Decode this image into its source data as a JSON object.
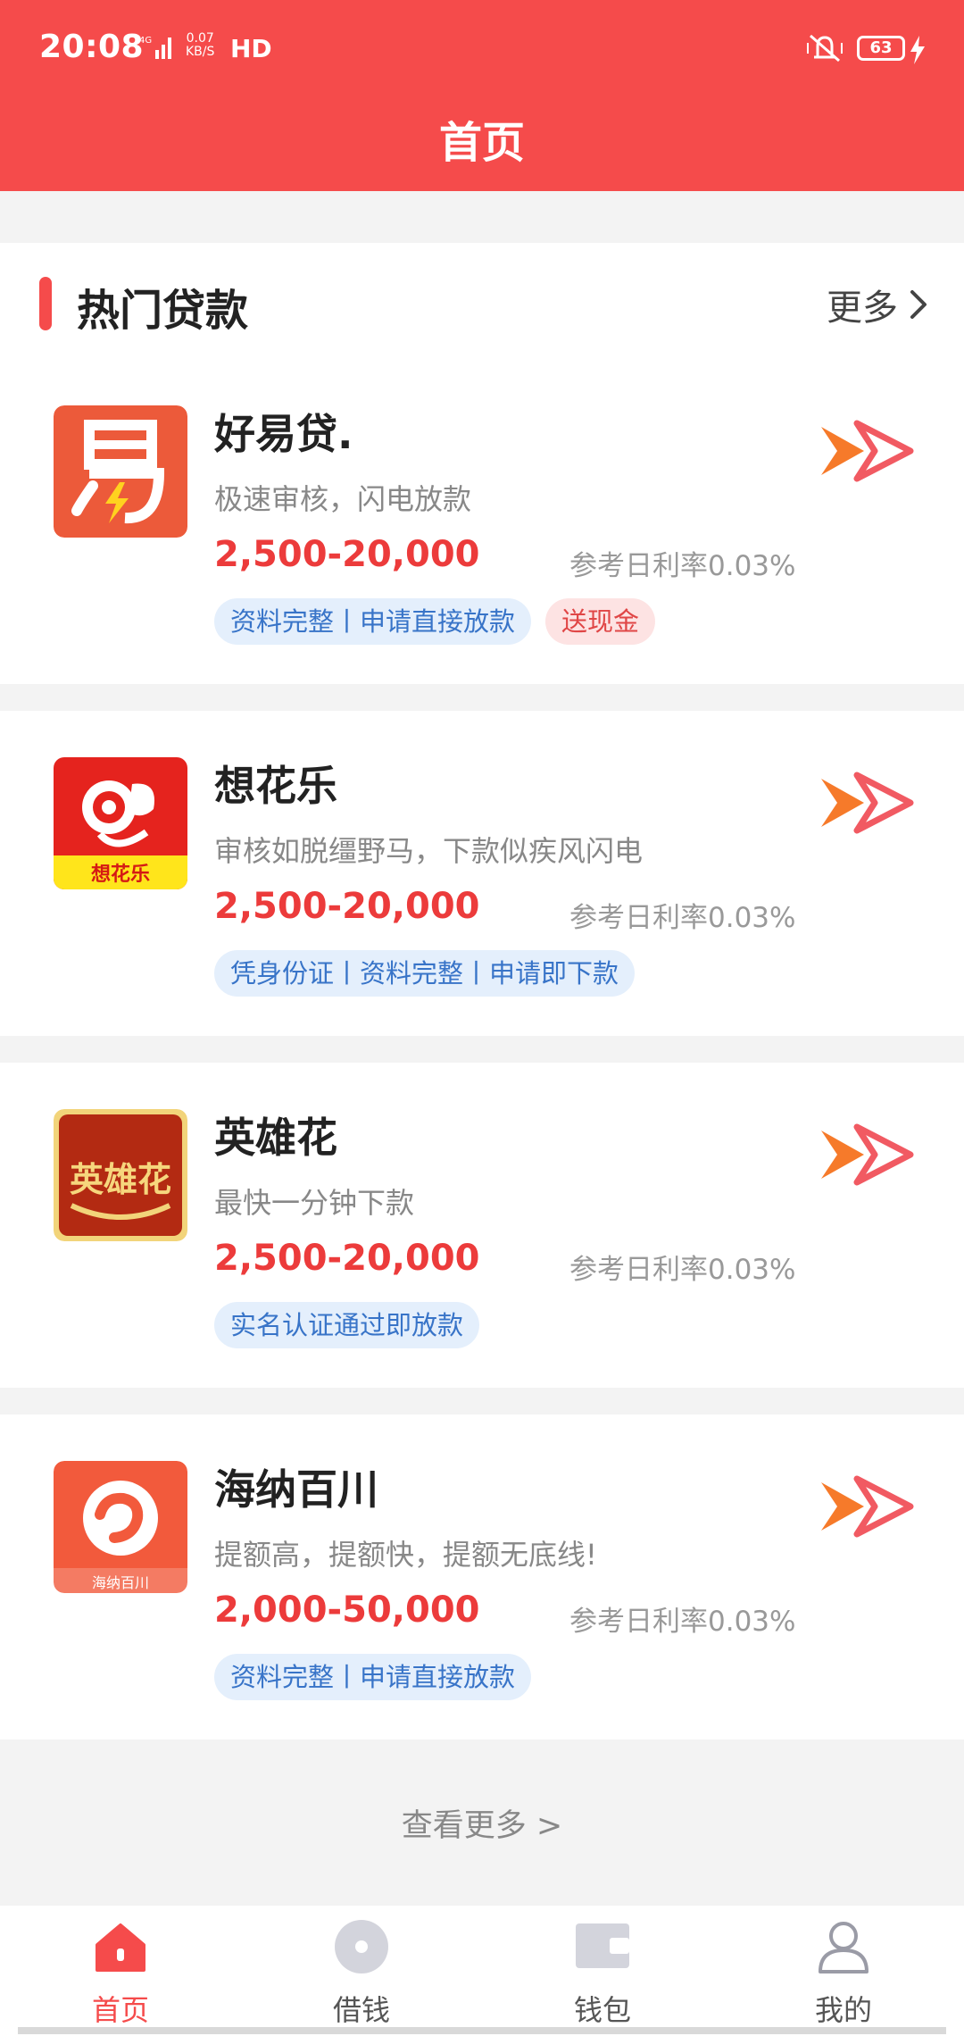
{
  "status_bar": {
    "time": "20:08",
    "net_type": "4G",
    "speed_value": "0.07",
    "speed_unit": "KB/S",
    "hd": "HD",
    "battery": "63"
  },
  "header": {
    "title": "首页"
  },
  "section": {
    "title": "热门贷款",
    "more": "更多"
  },
  "loans": [
    {
      "name": "好易贷.",
      "desc": "极速审核，闪电放款",
      "amount": "2,500-20,000",
      "rate": "参考日利率0.03%",
      "tags": [
        {
          "text": "资料完整丨申请直接放款",
          "style": "blue"
        },
        {
          "text": "送现金",
          "style": "red"
        }
      ],
      "logo_color": "#ec5a3a",
      "logo_text": "易"
    },
    {
      "name": "想花乐",
      "desc": "审核如脱缰野马，下款似疾风闪电",
      "amount": "2,500-20,000",
      "rate": "参考日利率0.03%",
      "tags": [
        {
          "text": "凭身份证丨资料完整丨申请即下款",
          "style": "blue"
        }
      ],
      "logo_color": "#e5231e",
      "logo_text": "想花乐"
    },
    {
      "name": "英雄花",
      "desc": "最快一分钟下款",
      "amount": "2,500-20,000",
      "rate": "参考日利率0.03%",
      "tags": [
        {
          "text": "实名认证通过即放款",
          "style": "blue"
        }
      ],
      "logo_color": "#b32a12",
      "logo_text": "英雄花"
    },
    {
      "name": "海纳百川",
      "desc": "提额高，提额快，提额无底线!",
      "amount": "2,000-50,000",
      "rate": "参考日利率0.03%",
      "tags": [
        {
          "text": "资料完整丨申请直接放款",
          "style": "blue"
        }
      ],
      "logo_color": "#f25a3c",
      "logo_text": "海纳百川"
    }
  ],
  "view_more": "查看更多 >",
  "nav": [
    {
      "label": "首页",
      "active": true,
      "icon": "home-icon"
    },
    {
      "label": "借钱",
      "active": false,
      "icon": "coin-icon"
    },
    {
      "label": "钱包",
      "active": false,
      "icon": "wallet-icon"
    },
    {
      "label": "我的",
      "active": false,
      "icon": "user-icon"
    }
  ],
  "colors": {
    "brand": "#f54b4b",
    "amount": "#ec3b3b",
    "tag_blue_bg": "#e4effc",
    "tag_blue_text": "#3874c8",
    "tag_red_bg": "#fde3e3",
    "tag_red_text": "#e04646"
  }
}
